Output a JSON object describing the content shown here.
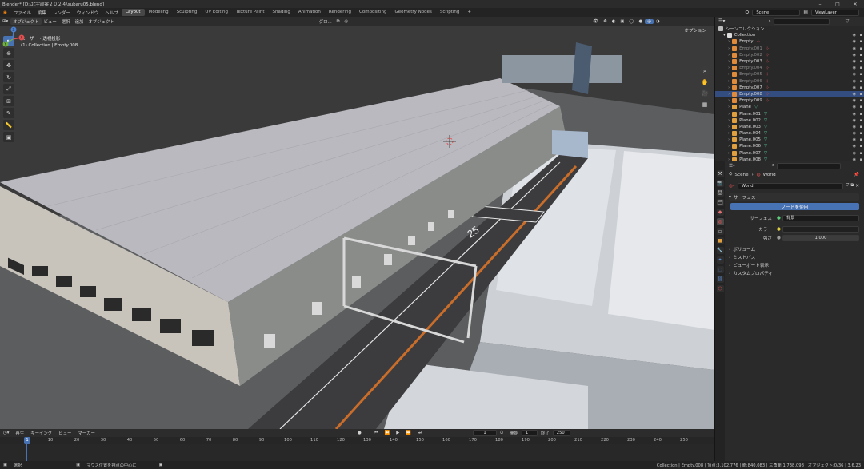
{
  "titlebar": {
    "title": "Blender* [D:\\北宇部案２０２４\\subaru05.blend]"
  },
  "menu": [
    "ファイル",
    "編集",
    "レンダー",
    "ウィンドウ",
    "ヘルプ"
  ],
  "workspaces": [
    "Layout",
    "Modeling",
    "Sculpting",
    "UV Editing",
    "Texture Paint",
    "Shading",
    "Animation",
    "Rendering",
    "Compositing",
    "Geometry Nodes",
    "Scripting"
  ],
  "active_workspace": "Layout",
  "add_workspace": "+",
  "scene_field": "Scene",
  "viewlayer_field": "ViewLayer",
  "viewport_header": {
    "mode": "オブジェクト",
    "menus": [
      "ビュー",
      "選択",
      "追加",
      "オブジェクト"
    ],
    "transform": "グロ...",
    "options": "オプション"
  },
  "viewport_info": {
    "line1": "ユーザー・透視投影",
    "line2": "(1) Collection | Empty.008"
  },
  "tools": [
    "select",
    "cursor",
    "move",
    "rotate",
    "scale",
    "transform",
    "annotate",
    "measure",
    "add-cube"
  ],
  "gizmo": {
    "x": "X",
    "y": "Y",
    "z": "Z"
  },
  "timeline_header": {
    "menus": [
      "再生",
      "キーイング",
      "ビュー",
      "マーカー"
    ],
    "current_frame": "1",
    "start_label": "開始",
    "start": "1",
    "end_label": "終了",
    "end": "250"
  },
  "ruler_ticks": [
    "10",
    "20",
    "30",
    "40",
    "50",
    "60",
    "70",
    "80",
    "90",
    "100",
    "110",
    "120",
    "130",
    "140",
    "150",
    "160",
    "170",
    "180",
    "190",
    "200",
    "210",
    "220",
    "230",
    "240",
    "250"
  ],
  "playhead": "1",
  "status": {
    "left": "選択",
    "middle": "マウス位置を視点の中心に",
    "right": "Collection | Empty.008 | 頂点:3,102,776 | 面:840,083 | 三角面:1,738,098 | オブジェクト:0/36 | 3.6.23"
  },
  "outliner": {
    "root": "シーンコレクション",
    "collection": "Collection",
    "items": [
      {
        "name": "Empty",
        "type": "empty",
        "dim": false,
        "sel": false
      },
      {
        "name": "Empty.001",
        "type": "empty",
        "dim": true,
        "sel": false
      },
      {
        "name": "Empty.002",
        "type": "empty",
        "dim": true,
        "sel": false
      },
      {
        "name": "Empty.003",
        "type": "empty",
        "dim": false,
        "sel": false
      },
      {
        "name": "Empty.004",
        "type": "empty",
        "dim": true,
        "sel": false
      },
      {
        "name": "Empty.005",
        "type": "empty",
        "dim": true,
        "sel": false
      },
      {
        "name": "Empty.006",
        "type": "empty",
        "dim": true,
        "sel": false
      },
      {
        "name": "Empty.007",
        "type": "empty",
        "dim": false,
        "sel": false
      },
      {
        "name": "Empty.008",
        "type": "empty",
        "dim": false,
        "sel": true
      },
      {
        "name": "Empty.009",
        "type": "empty",
        "dim": false,
        "sel": false
      },
      {
        "name": "Plane",
        "type": "mesh",
        "dim": false,
        "sel": false
      },
      {
        "name": "Plane.001",
        "type": "mesh",
        "dim": false,
        "sel": false
      },
      {
        "name": "Plane.002",
        "type": "mesh",
        "dim": false,
        "sel": false
      },
      {
        "name": "Plane.003",
        "type": "mesh",
        "dim": false,
        "sel": false
      },
      {
        "name": "Plane.004",
        "type": "mesh",
        "dim": false,
        "sel": false
      },
      {
        "name": "Plane.005",
        "type": "mesh",
        "dim": false,
        "sel": false
      },
      {
        "name": "Plane.006",
        "type": "mesh",
        "dim": false,
        "sel": false
      },
      {
        "name": "Plane.007",
        "type": "mesh",
        "dim": false,
        "sel": false
      },
      {
        "name": "Plane.008",
        "type": "mesh",
        "dim": false,
        "sel": false
      }
    ]
  },
  "properties": {
    "breadcrumb_scene": "Scene",
    "breadcrumb_world": "World",
    "world_name": "World",
    "surface_panel": "サーフェス",
    "use_nodes": "ノードを使用",
    "surface_label": "サーフェス",
    "surface_value": "背景",
    "color_label": "カラー",
    "strength_label": "強さ",
    "strength_value": "1.000",
    "volume_panel": "ボリューム",
    "mist_panel": "ミストパス",
    "viewport_panel": "ビューポート表示",
    "custom_panel": "カスタムプロパティ"
  },
  "road_marking": "25",
  "colors": {
    "accent": "#4772b3",
    "selected_row": "#334d80",
    "empty_icon": "#e08a3c",
    "mesh_icon": "#e0a040",
    "roof": "#b9b9bf",
    "road": "#3c3c3e",
    "orange_line": "#c96d2a"
  }
}
